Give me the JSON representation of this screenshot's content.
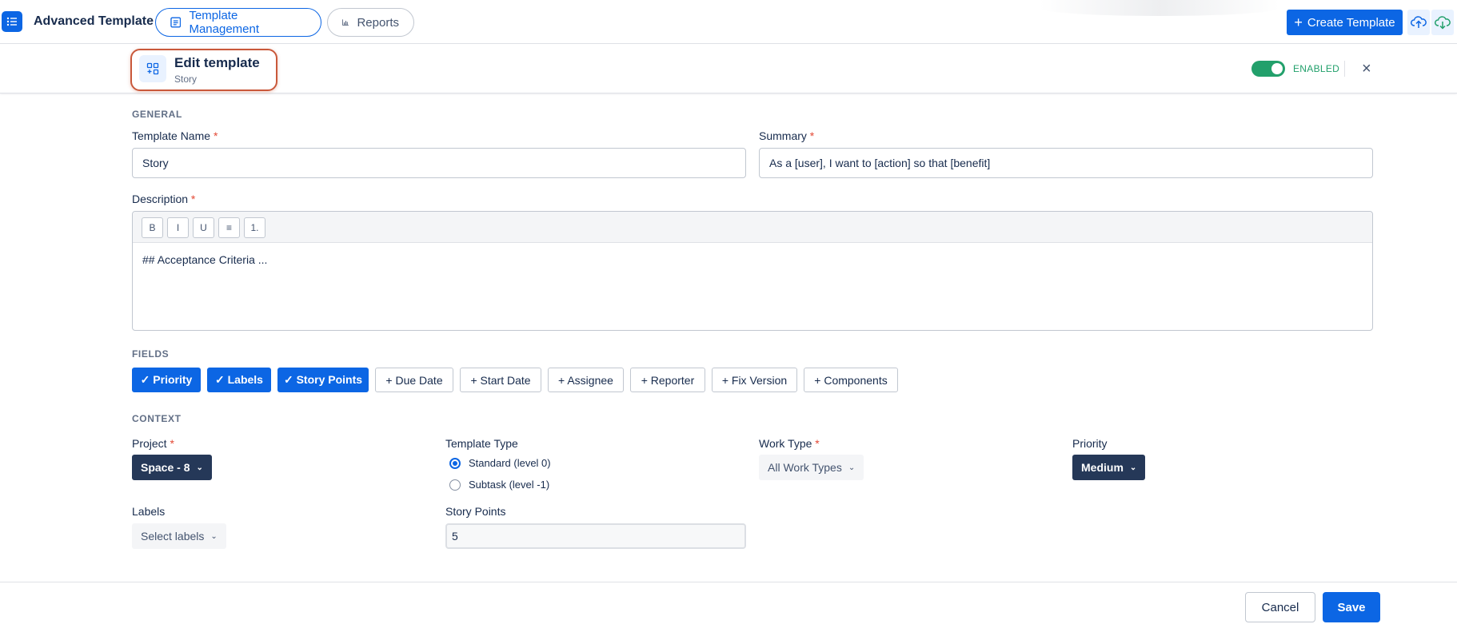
{
  "app": {
    "title": "Advanced Template"
  },
  "tabs": [
    {
      "label": "Template Management",
      "active": true
    },
    {
      "label": "Reports",
      "active": false
    }
  ],
  "toolbar": {
    "create_label": "Create Template"
  },
  "header": {
    "title": "Edit template",
    "subtitle": "Story",
    "status": "ENABLED",
    "enabled": true
  },
  "general": {
    "section": "GENERAL",
    "template_name_label": "Template Name",
    "template_name_value": "Story",
    "summary_label": "Summary",
    "summary_value": "As a [user], I want to [action] so that [benefit]",
    "description_label": "Description",
    "description_value": "## Acceptance Criteria ...",
    "editor_buttons": [
      "B",
      "I",
      "U",
      "≡",
      "1."
    ]
  },
  "fields": {
    "section": "FIELDS",
    "chips": [
      {
        "label": "✓ Priority",
        "selected": true
      },
      {
        "label": "✓ Labels",
        "selected": true
      },
      {
        "label": "✓ Story Points",
        "selected": true
      },
      {
        "label": "+ Due Date",
        "selected": false
      },
      {
        "label": "+ Start Date",
        "selected": false
      },
      {
        "label": "+ Assignee",
        "selected": false
      },
      {
        "label": "+ Reporter",
        "selected": false
      },
      {
        "label": "+ Fix Version",
        "selected": false
      },
      {
        "label": "+ Components",
        "selected": false
      }
    ]
  },
  "context": {
    "section": "CONTEXT",
    "project_label": "Project",
    "project_value": "Space - 8",
    "template_type_label": "Template Type",
    "template_type_options": [
      {
        "label": "Standard (level 0)",
        "selected": true
      },
      {
        "label": "Subtask (level -1)",
        "selected": false
      }
    ],
    "work_type_label": "Work Type",
    "work_type_value": "All Work Types",
    "priority_label": "Priority",
    "priority_value": "Medium",
    "labels_label": "Labels",
    "labels_value": "Select labels",
    "story_points_label": "Story Points",
    "story_points_value": "5"
  },
  "footer": {
    "cancel_label": "Cancel",
    "save_label": "Save"
  },
  "colors": {
    "accent": "#0c66e4",
    "success": "#22a06b",
    "dark_button": "#253858",
    "required": "#e34935"
  },
  "icons": [
    "list-icon",
    "template-icon",
    "chart-icon",
    "plus-icon",
    "cloud-upload-icon",
    "cloud-download-icon",
    "layout-icon",
    "close-icon",
    "chevron-down-icon"
  ]
}
